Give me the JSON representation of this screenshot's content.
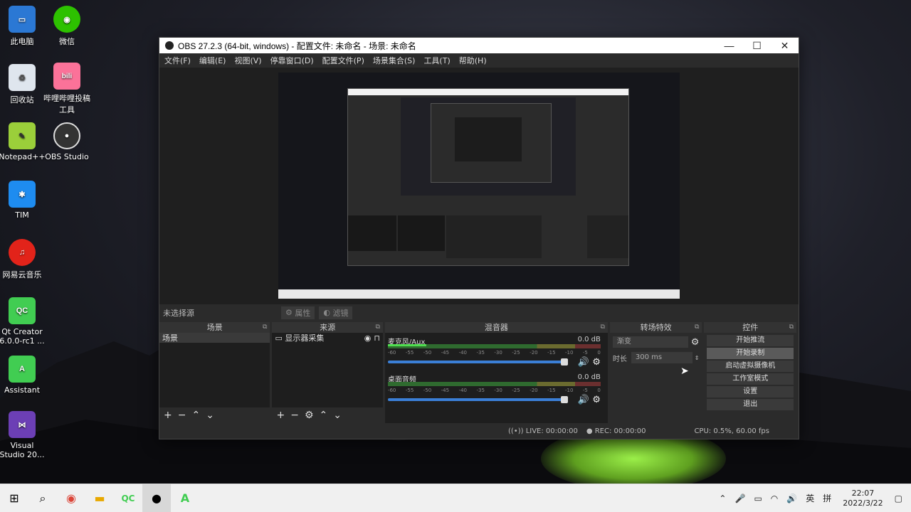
{
  "desktop": {
    "icons": [
      {
        "label": "此电脑",
        "icon": "computer-icon"
      },
      {
        "label": "微信",
        "icon": "wechat-icon"
      },
      {
        "label": "回收站",
        "icon": "recycle-bin-icon"
      },
      {
        "label": "哔哩哔哩投稿\n工具",
        "icon": "bilibili-icon"
      },
      {
        "label": "Notepad++",
        "icon": "notepadpp-icon"
      },
      {
        "label": "OBS Studio",
        "icon": "obs-icon"
      },
      {
        "label": "TIM",
        "icon": "tim-icon"
      },
      {
        "label": "网易云音乐",
        "icon": "netease-music-icon"
      },
      {
        "label": "Qt Creator\n6.0.0-rc1 ...",
        "icon": "qt-creator-icon"
      },
      {
        "label": "Assistant",
        "icon": "assistant-icon"
      },
      {
        "label": "Visual\nStudio 20...",
        "icon": "visual-studio-icon"
      }
    ]
  },
  "window": {
    "title": "OBS 27.2.3 (64-bit, windows) - 配置文件: 未命名 - 场景: 未命名",
    "minimize": "—",
    "maximize": "☐",
    "close": "✕"
  },
  "menu": [
    "文件(F)",
    "编辑(E)",
    "视图(V)",
    "停靠窗口(D)",
    "配置文件(P)",
    "场景集合(S)",
    "工具(T)",
    "帮助(H)"
  ],
  "source_bar": {
    "no_source": "未选择源",
    "properties": "属性",
    "filters": "滤镜"
  },
  "docks": {
    "scenes": {
      "title": "场景",
      "items": [
        "场景"
      ]
    },
    "sources": {
      "title": "来源",
      "items": [
        "显示器采集"
      ]
    },
    "mixer": {
      "title": "混音器",
      "channels": [
        {
          "name": "麦克风/Aux",
          "db": "0.0 dB"
        },
        {
          "name": "桌面音频",
          "db": "0.0 dB"
        }
      ],
      "ticks": [
        "-60",
        "-55",
        "-50",
        "-45",
        "-40",
        "-35",
        "-30",
        "-25",
        "-20",
        "-15",
        "-10",
        "-5",
        "0"
      ]
    },
    "transitions": {
      "title": "转场特效",
      "selected": "渐变",
      "duration_label": "时长",
      "duration": "300 ms"
    },
    "controls": {
      "title": "控件",
      "buttons": [
        "开始推流",
        "开始录制",
        "启动虚拟摄像机",
        "工作室模式",
        "设置",
        "退出"
      ]
    }
  },
  "status": {
    "live": "LIVE: 00:00:00",
    "rec": "REC: 00:00:00",
    "cpu": "CPU: 0.5%, 60.00 fps"
  },
  "taskbar": {
    "tray_lang": "英",
    "tray_ime": "拼",
    "time": "22:07",
    "date": "2022/3/22"
  }
}
